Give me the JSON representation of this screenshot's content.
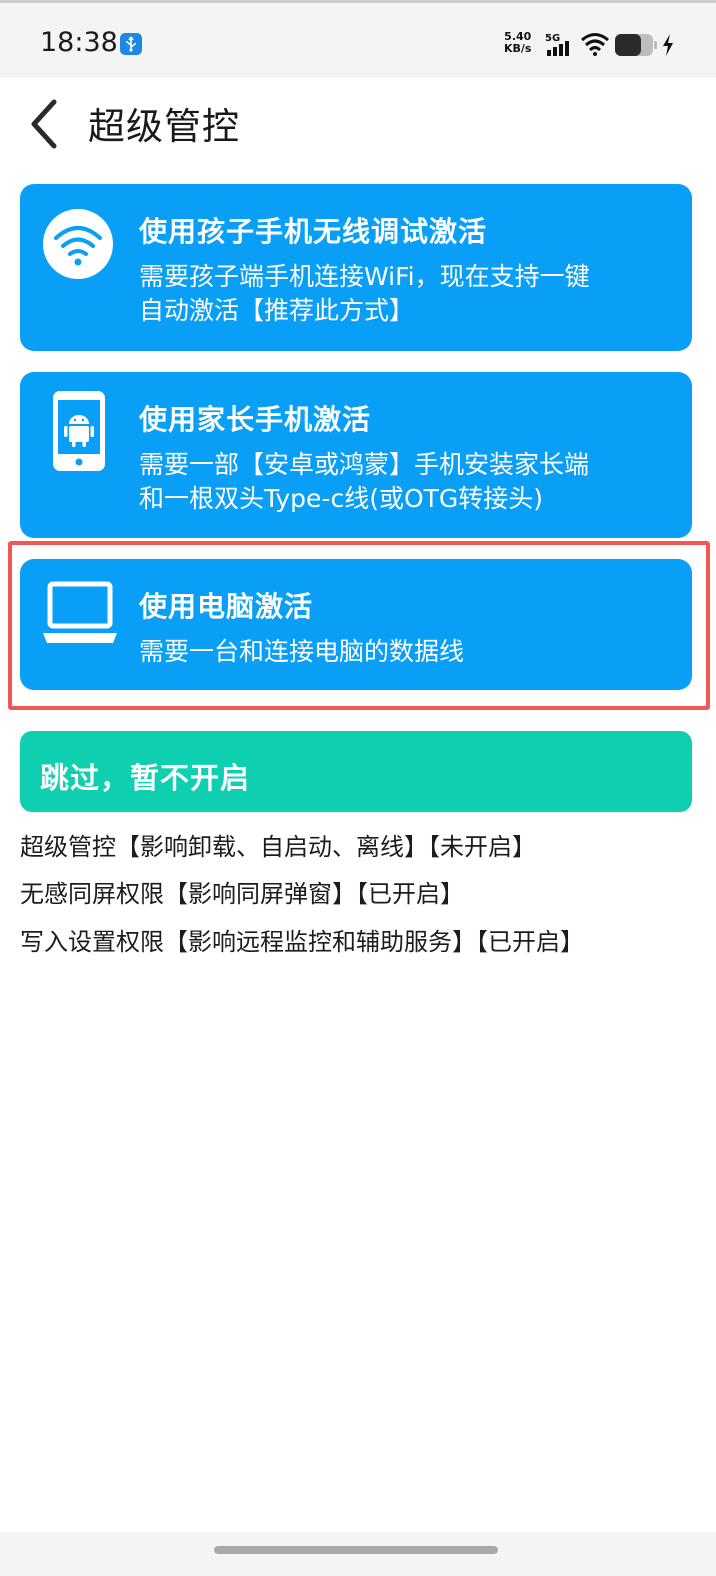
{
  "status_bar": {
    "time": "18:38",
    "net_speed_value": "5.40",
    "net_speed_unit": "KB/s",
    "network_type": "5G",
    "icons": [
      "usb-icon",
      "signal-icon",
      "wifi-icon",
      "battery-icon",
      "charging-icon"
    ]
  },
  "header": {
    "title": "超级管控"
  },
  "options": [
    {
      "icon": "wifi-icon",
      "title": "使用孩子手机无线调试激活",
      "desc_line1": "需要孩子端手机连接WiFi，现在支持一键",
      "desc_line2": "自动激活【推荐此方式】"
    },
    {
      "icon": "android-phone-icon",
      "title": "使用家长手机激活",
      "desc_line1": "需要一部【安卓或鸿蒙】手机安装家长端",
      "desc_line2": "和一根双头Type-c线(或OTG转接头)"
    },
    {
      "icon": "laptop-icon",
      "title": "使用电脑激活",
      "desc_line1": "需要一台和连接电脑的数据线"
    }
  ],
  "skip_button": {
    "label": "跳过，暂不开启"
  },
  "permission_status": [
    "超级管控【影响卸载、自启动、离线】【未开启】",
    "无感同屏权限【影响同屏弹窗】【已开启】",
    "写入设置权限【影响远程监控和辅助服务】【已开启】"
  ],
  "colors": {
    "card_blue": "#0a9ff7",
    "skip_green": "#0fcfb1",
    "highlight_red": "#f25656"
  }
}
